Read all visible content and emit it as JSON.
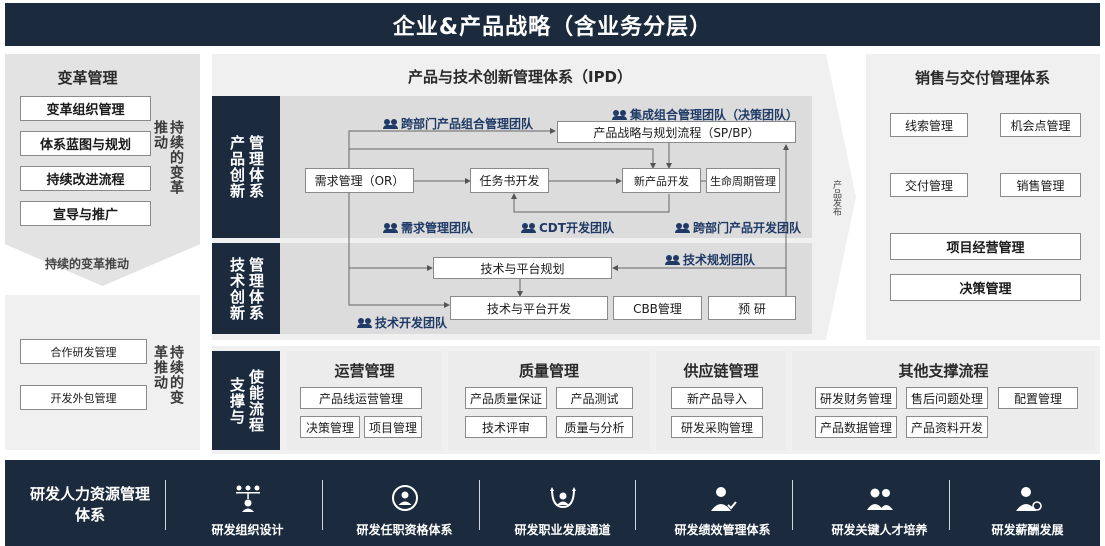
{
  "title": "企业&产品战略（含业务分层）",
  "change_mgmt": {
    "title": "变革管理",
    "items": [
      "变革组织管理",
      "体系蓝图与规划",
      "持续改进流程",
      "宣导与推广"
    ],
    "vertical_label": "持续的变革",
    "side_left_label": "推动",
    "bottom_label": "持续的变革推动"
  },
  "collab": {
    "items": [
      "合作研发管理",
      "开发外包管理"
    ],
    "vertical_label": "持续的变",
    "side_left_label": "革推动"
  },
  "ipd": {
    "title": "产品与技术创新管理体系（IPD）",
    "product_label": "产品创新",
    "product_sublabel": "管理体系",
    "tech_label": "技术创新",
    "tech_sublabel": "管理体系",
    "teams": {
      "portfolio": "跨部门产品组合管理团队",
      "integrated": "集成组合管理团队（决策团队）",
      "demand": "需求管理团队",
      "cdt": "CDT开发团队",
      "pdt": "跨部门产品开发团队",
      "tech_plan": "技术规划团队",
      "tech_dev": "技术开发团队"
    },
    "boxes": {
      "strategy": "产品战略与规划流程（SP/BP）",
      "demand": "需求管理（OR）",
      "charter": "任务书开发",
      "npd": "新产品开发",
      "lifecycle": "生命周期管理",
      "tech_plan": "技术与平台规划",
      "tech_dev": "技术与平台开发",
      "cbb": "CBB管理",
      "research": "预 研"
    },
    "release_label": "产品发布"
  },
  "sales": {
    "title": "销售与交付管理体系",
    "boxes": {
      "lead": "线索管理",
      "opportunity": "机会点管理",
      "delivery": "交付管理",
      "sales": "销售管理",
      "project": "项目经营管理",
      "decision": "决策管理"
    }
  },
  "support": {
    "label": "支撑与使能流程",
    "label_a": "使能流程",
    "label_b": "支撑与",
    "groups": [
      {
        "title": "运营管理",
        "items": [
          "产品线运营管理",
          "决策管理",
          "项目管理"
        ]
      },
      {
        "title": "质量管理",
        "items": [
          "产品质量保证",
          "产品测试",
          "技术评审",
          "质量与分析"
        ]
      },
      {
        "title": "供应链管理",
        "items": [
          "新产品导入",
          "研发采购管理"
        ]
      },
      {
        "title": "其他支撑流程",
        "items": [
          "研发财务管理",
          "售后问题处理",
          "配置管理",
          "产品数据管理",
          "产品资料开发"
        ]
      }
    ]
  },
  "hr": {
    "title": "研发人力资源管理体系",
    "items": [
      {
        "label": "研发组织设计",
        "icon": "org-chart-icon"
      },
      {
        "label": "研发任职资格体系",
        "icon": "person-badge-icon"
      },
      {
        "label": "研发职业发展通道",
        "icon": "career-path-icon"
      },
      {
        "label": "研发绩效管理体系",
        "icon": "person-check-icon"
      },
      {
        "label": "研发关键人才培养",
        "icon": "people-icon"
      },
      {
        "label": "研发薪酬发展",
        "icon": "person-coin-icon"
      }
    ]
  },
  "colors": {
    "dark": "#1b2b3d",
    "panel": "#f0f0f0",
    "team_text": "#1f3a66"
  }
}
